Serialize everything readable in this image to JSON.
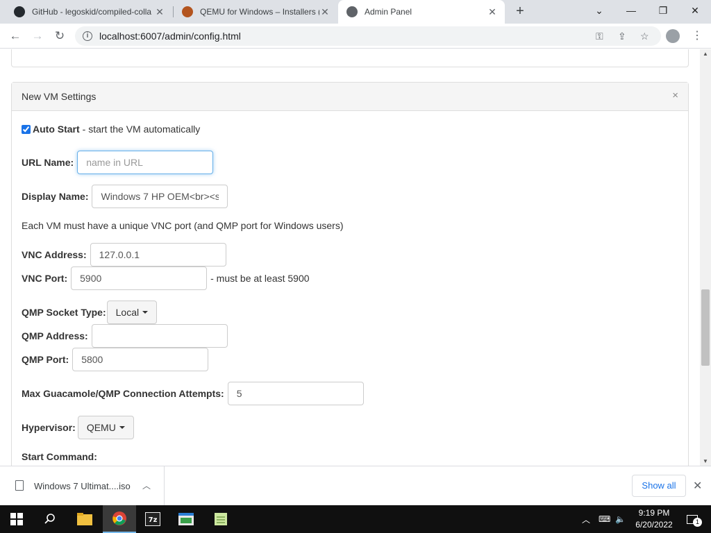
{
  "browser": {
    "tabs": [
      {
        "title": "GitHub - legoskid/compiled-colla",
        "active": false
      },
      {
        "title": "QEMU for Windows – Installers (6",
        "active": false
      },
      {
        "title": "Admin Panel",
        "active": true
      }
    ],
    "url": "localhost:6007/admin/config.html"
  },
  "panel": {
    "title": "New VM Settings",
    "close": "×"
  },
  "form": {
    "auto_start": {
      "label": "Auto Start",
      "desc": "- start the VM automatically",
      "checked": true
    },
    "url_name": {
      "label": "URL Name:",
      "placeholder": "name in URL",
      "value": ""
    },
    "display_name": {
      "label": "Display Name:",
      "value": "Windows 7 HP OEM<br><s"
    },
    "vnc_note": "Each VM must have a unique VNC port (and QMP port for Windows users)",
    "vnc_address": {
      "label": "VNC Address:",
      "value": "127.0.0.1"
    },
    "vnc_port": {
      "label": "VNC Port:",
      "value": "5900",
      "hint": "- must be at least 5900"
    },
    "qmp_socket_type": {
      "label": "QMP Socket Type:",
      "value": "Local"
    },
    "qmp_address": {
      "label": "QMP Address:",
      "value": ""
    },
    "qmp_port": {
      "label": "QMP Port:",
      "value": "5800"
    },
    "max_attempts": {
      "label": "Max Guacamole/QMP Connection Attempts:",
      "value": "5"
    },
    "hypervisor": {
      "label": "Hypervisor:",
      "value": "QEMU"
    },
    "start_command": {
      "label": "Start Command:"
    }
  },
  "downloads": {
    "file_name": "Windows 7 Ultimat....iso",
    "show_all": "Show all"
  },
  "taskbar": {
    "time": "9:19 PM",
    "date": "6/20/2022",
    "notification_count": "1"
  },
  "colors": {
    "accent": "#1a73e8",
    "focus_border": "#66afe9",
    "panel_heading": "#f5f5f5"
  }
}
